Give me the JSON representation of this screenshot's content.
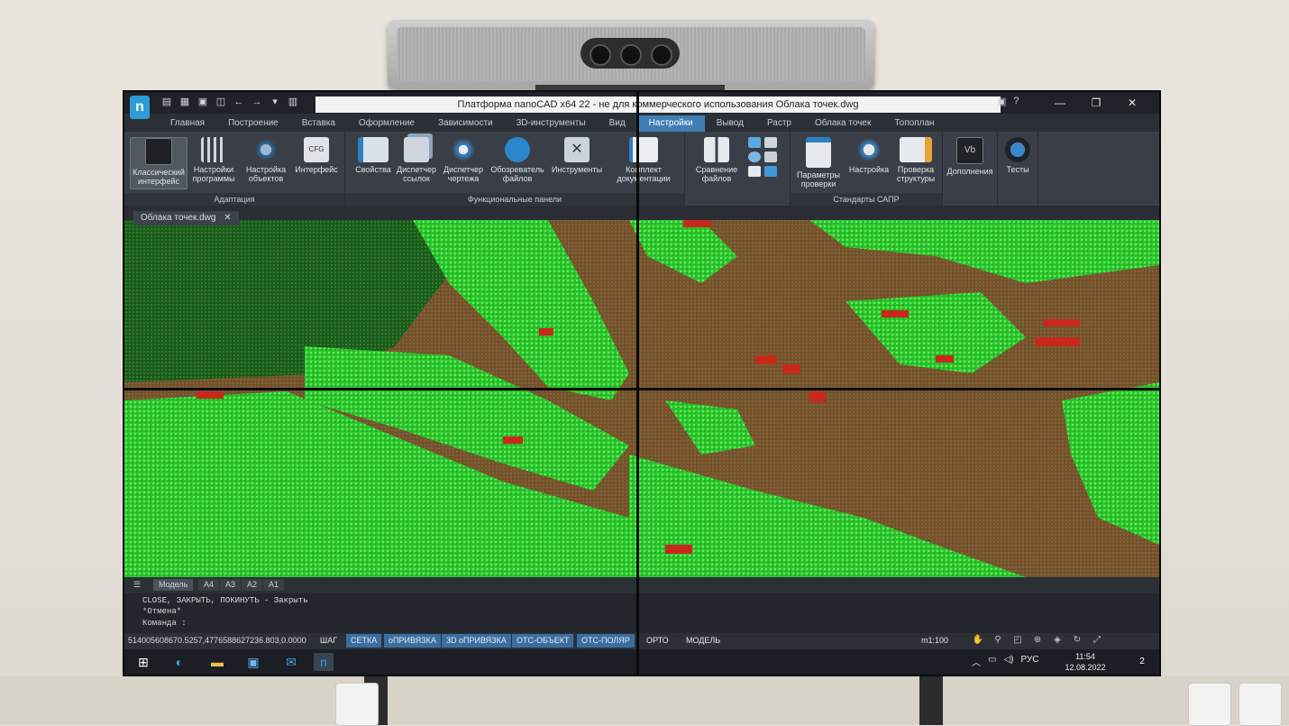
{
  "window": {
    "title": "Платформа nanoCAD x64 22 - не для коммерческого использования Облака точек.dwg",
    "minimize": "—",
    "maximize": "❐",
    "close": "✕",
    "help": "?"
  },
  "logo": "n",
  "quick_access": [
    "▤",
    "▦",
    "▣",
    "◫",
    "←",
    "→",
    "▾",
    "▥"
  ],
  "tabs": [
    "Главная",
    "Построение",
    "Вставка",
    "Оформление",
    "Зависимости",
    "3D-инструменты",
    "Вид",
    "Настройки",
    "Вывод",
    "Растр",
    "Облака точек",
    "Топоплан"
  ],
  "active_tab": "Настройки",
  "ribbon": {
    "groups": [
      {
        "label": "Адаптация",
        "buttons": [
          "Классический интерфейс",
          "Настройки программы",
          "Настройка объектов",
          "Интерфейс"
        ]
      },
      {
        "label": "Функциональные панели",
        "buttons": [
          "Свойства",
          "Диспетчер ссылок",
          "Диспетчер чертежа",
          "Обозреватель файлов",
          "Инструменты",
          "Комплект документации"
        ]
      },
      {
        "label": "",
        "buttons": [
          "Сравнение файлов"
        ]
      },
      {
        "label": "Стандарты САПР",
        "buttons": [
          "Параметры проверки",
          "Настройка",
          "Проверка структуры"
        ]
      },
      {
        "label": "",
        "buttons": [
          "Дополнения",
          "Тесты"
        ]
      }
    ]
  },
  "document_tab": "Облака точек.dwg",
  "document_tab_close": "✕",
  "layout_tabs": [
    "Модель",
    "A4",
    "A3",
    "A2",
    "A1"
  ],
  "command_lines": [
    "CLOSE, ЗАКРЫТЬ, ПОКИНУТЬ - Закрыть",
    "*Отмена*",
    "Команда :"
  ],
  "status": {
    "coords": "514005608670.5257,4776588627236.803,0.0000",
    "buttons": [
      "ШАГ",
      "СЕТКА",
      "оПРИВЯЗКА",
      "3D оПРИВЯЗКА",
      "ОТС-ОБЪЕКТ",
      "ОТС-ПОЛЯР",
      "ОРТО",
      "МОДЕЛЬ"
    ],
    "active_buttons": [
      "СЕТКА",
      "оПРИВЯЗКА",
      "3D оПРИВЯЗКА",
      "ОТС-ОБЪЕКТ",
      "ОТС-ПОЛЯР"
    ],
    "scale": "m1:100"
  },
  "taskbar": {
    "tray_lang": "РУС",
    "time": "11:54",
    "date": "12.08.2022",
    "notifications": "2"
  },
  "colors": {
    "accent": "#3f7fb6",
    "vegetation": "#33d433",
    "terrain": "#7a552c",
    "buildings": "#c8281c"
  }
}
